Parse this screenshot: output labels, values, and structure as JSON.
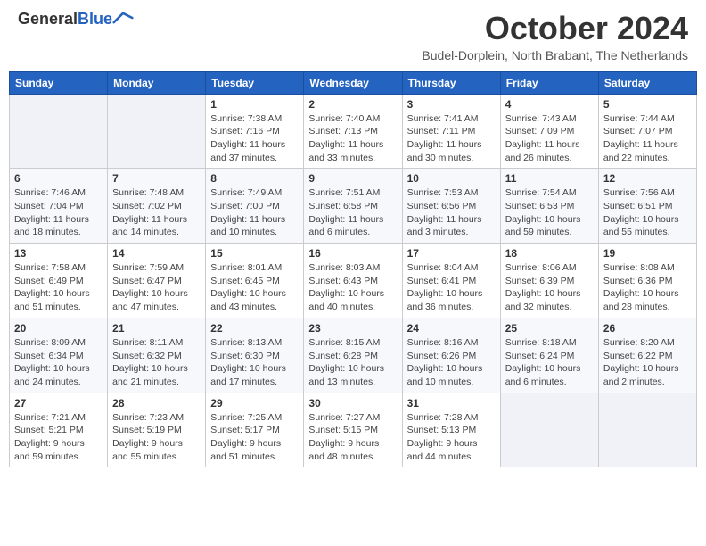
{
  "header": {
    "logo_line1": "General",
    "logo_line2": "Blue",
    "month": "October 2024",
    "location": "Budel-Dorplein, North Brabant, The Netherlands"
  },
  "weekdays": [
    "Sunday",
    "Monday",
    "Tuesday",
    "Wednesday",
    "Thursday",
    "Friday",
    "Saturday"
  ],
  "weeks": [
    [
      {
        "day": "",
        "info": ""
      },
      {
        "day": "",
        "info": ""
      },
      {
        "day": "1",
        "info": "Sunrise: 7:38 AM\nSunset: 7:16 PM\nDaylight: 11 hours and 37 minutes."
      },
      {
        "day": "2",
        "info": "Sunrise: 7:40 AM\nSunset: 7:13 PM\nDaylight: 11 hours and 33 minutes."
      },
      {
        "day": "3",
        "info": "Sunrise: 7:41 AM\nSunset: 7:11 PM\nDaylight: 11 hours and 30 minutes."
      },
      {
        "day": "4",
        "info": "Sunrise: 7:43 AM\nSunset: 7:09 PM\nDaylight: 11 hours and 26 minutes."
      },
      {
        "day": "5",
        "info": "Sunrise: 7:44 AM\nSunset: 7:07 PM\nDaylight: 11 hours and 22 minutes."
      }
    ],
    [
      {
        "day": "6",
        "info": "Sunrise: 7:46 AM\nSunset: 7:04 PM\nDaylight: 11 hours and 18 minutes."
      },
      {
        "day": "7",
        "info": "Sunrise: 7:48 AM\nSunset: 7:02 PM\nDaylight: 11 hours and 14 minutes."
      },
      {
        "day": "8",
        "info": "Sunrise: 7:49 AM\nSunset: 7:00 PM\nDaylight: 11 hours and 10 minutes."
      },
      {
        "day": "9",
        "info": "Sunrise: 7:51 AM\nSunset: 6:58 PM\nDaylight: 11 hours and 6 minutes."
      },
      {
        "day": "10",
        "info": "Sunrise: 7:53 AM\nSunset: 6:56 PM\nDaylight: 11 hours and 3 minutes."
      },
      {
        "day": "11",
        "info": "Sunrise: 7:54 AM\nSunset: 6:53 PM\nDaylight: 10 hours and 59 minutes."
      },
      {
        "day": "12",
        "info": "Sunrise: 7:56 AM\nSunset: 6:51 PM\nDaylight: 10 hours and 55 minutes."
      }
    ],
    [
      {
        "day": "13",
        "info": "Sunrise: 7:58 AM\nSunset: 6:49 PM\nDaylight: 10 hours and 51 minutes."
      },
      {
        "day": "14",
        "info": "Sunrise: 7:59 AM\nSunset: 6:47 PM\nDaylight: 10 hours and 47 minutes."
      },
      {
        "day": "15",
        "info": "Sunrise: 8:01 AM\nSunset: 6:45 PM\nDaylight: 10 hours and 43 minutes."
      },
      {
        "day": "16",
        "info": "Sunrise: 8:03 AM\nSunset: 6:43 PM\nDaylight: 10 hours and 40 minutes."
      },
      {
        "day": "17",
        "info": "Sunrise: 8:04 AM\nSunset: 6:41 PM\nDaylight: 10 hours and 36 minutes."
      },
      {
        "day": "18",
        "info": "Sunrise: 8:06 AM\nSunset: 6:39 PM\nDaylight: 10 hours and 32 minutes."
      },
      {
        "day": "19",
        "info": "Sunrise: 8:08 AM\nSunset: 6:36 PM\nDaylight: 10 hours and 28 minutes."
      }
    ],
    [
      {
        "day": "20",
        "info": "Sunrise: 8:09 AM\nSunset: 6:34 PM\nDaylight: 10 hours and 24 minutes."
      },
      {
        "day": "21",
        "info": "Sunrise: 8:11 AM\nSunset: 6:32 PM\nDaylight: 10 hours and 21 minutes."
      },
      {
        "day": "22",
        "info": "Sunrise: 8:13 AM\nSunset: 6:30 PM\nDaylight: 10 hours and 17 minutes."
      },
      {
        "day": "23",
        "info": "Sunrise: 8:15 AM\nSunset: 6:28 PM\nDaylight: 10 hours and 13 minutes."
      },
      {
        "day": "24",
        "info": "Sunrise: 8:16 AM\nSunset: 6:26 PM\nDaylight: 10 hours and 10 minutes."
      },
      {
        "day": "25",
        "info": "Sunrise: 8:18 AM\nSunset: 6:24 PM\nDaylight: 10 hours and 6 minutes."
      },
      {
        "day": "26",
        "info": "Sunrise: 8:20 AM\nSunset: 6:22 PM\nDaylight: 10 hours and 2 minutes."
      }
    ],
    [
      {
        "day": "27",
        "info": "Sunrise: 7:21 AM\nSunset: 5:21 PM\nDaylight: 9 hours and 59 minutes."
      },
      {
        "day": "28",
        "info": "Sunrise: 7:23 AM\nSunset: 5:19 PM\nDaylight: 9 hours and 55 minutes."
      },
      {
        "day": "29",
        "info": "Sunrise: 7:25 AM\nSunset: 5:17 PM\nDaylight: 9 hours and 51 minutes."
      },
      {
        "day": "30",
        "info": "Sunrise: 7:27 AM\nSunset: 5:15 PM\nDaylight: 9 hours and 48 minutes."
      },
      {
        "day": "31",
        "info": "Sunrise: 7:28 AM\nSunset: 5:13 PM\nDaylight: 9 hours and 44 minutes."
      },
      {
        "day": "",
        "info": ""
      },
      {
        "day": "",
        "info": ""
      }
    ]
  ]
}
